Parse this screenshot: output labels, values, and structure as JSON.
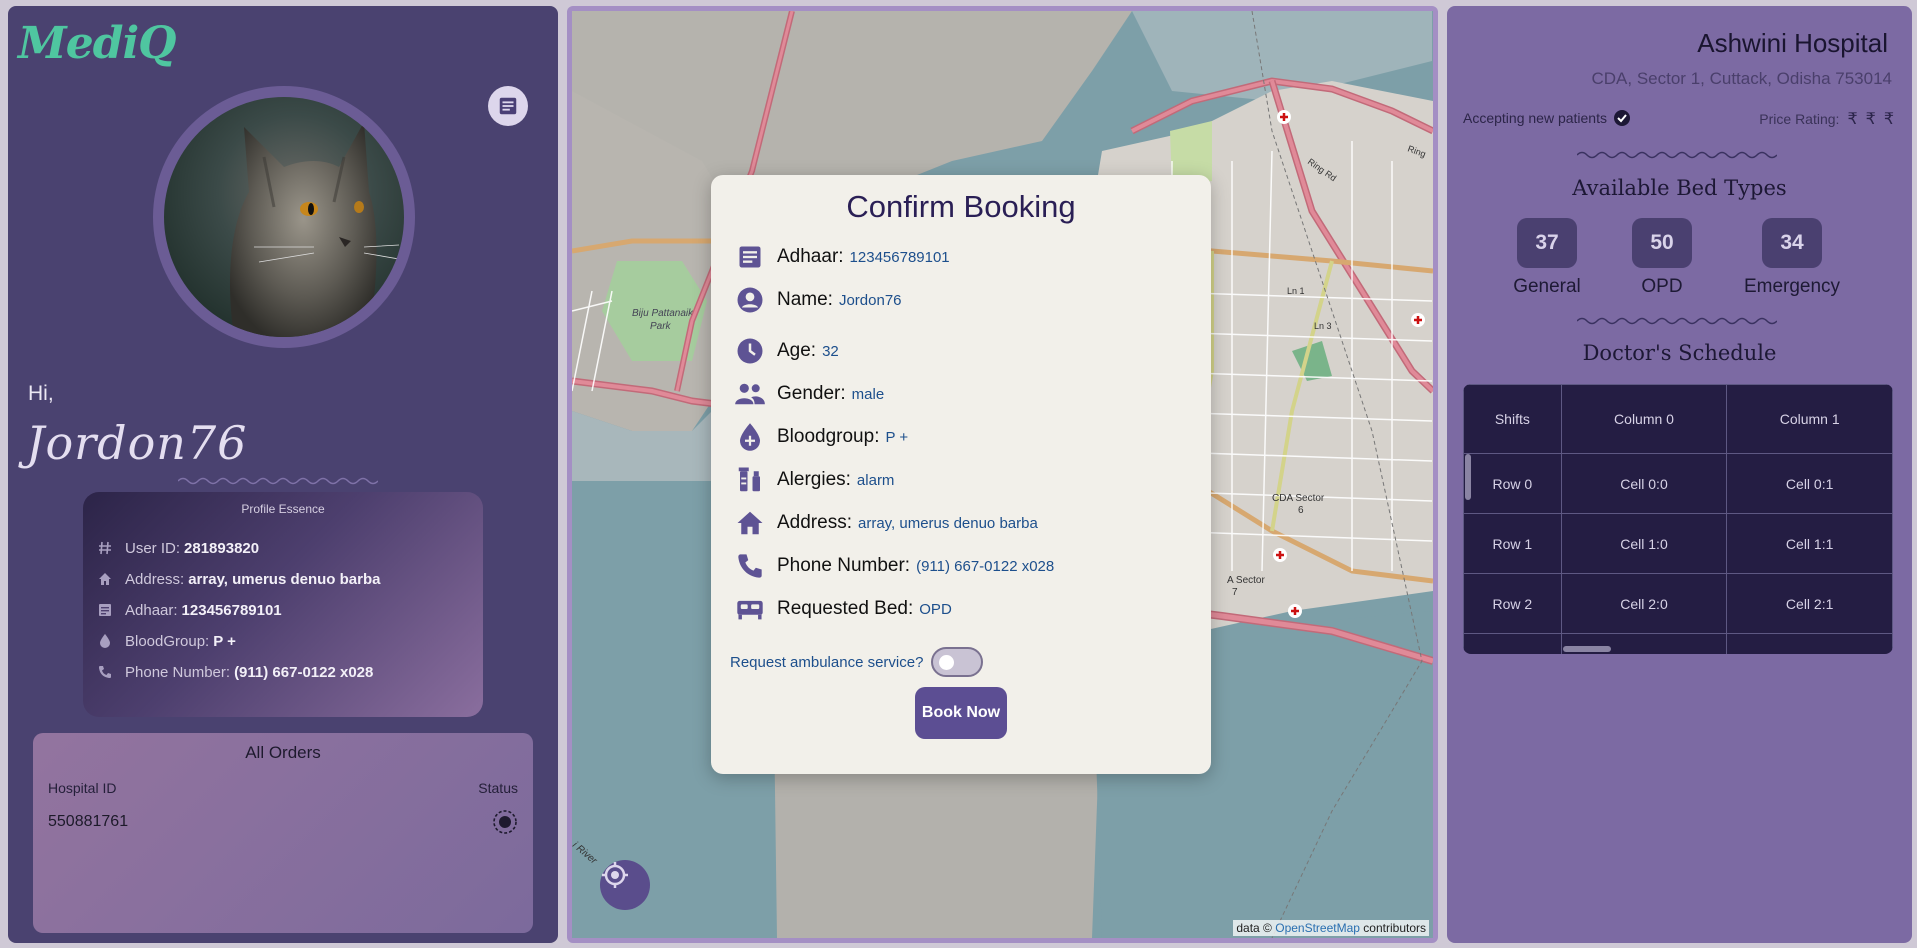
{
  "app": {
    "logo": "MediQ"
  },
  "profile": {
    "greeting": "Hi,",
    "username": "Jordon76",
    "essence_title": "Profile Essence",
    "rows": [
      {
        "icon": "hash-icon",
        "label": "User ID:",
        "value": "281893820"
      },
      {
        "icon": "home-icon",
        "label": "Address:",
        "value": "array, umerus denuo barba"
      },
      {
        "icon": "document-icon",
        "label": "Adhaar:",
        "value": "123456789101"
      },
      {
        "icon": "blood-drop-icon",
        "label": "BloodGroup:",
        "value": "P +"
      },
      {
        "icon": "phone-icon",
        "label": "Phone Number:",
        "value": "(911) 667-0122 x028"
      }
    ]
  },
  "orders": {
    "title": "All Orders",
    "col_hospital": "Hospital ID",
    "col_status": "Status",
    "items": [
      {
        "hospital_id": "550881761",
        "status_icon": "pending-status-icon"
      }
    ]
  },
  "map": {
    "attribution_prefix": "data ©",
    "attribution_link": "OpenStreetMap",
    "attribution_suffix": "contributors",
    "labels": {
      "park": "Biju Pattanaik Park",
      "sector6": "CDA Sector 6",
      "sector7": "A Sector 7",
      "ring": "Ring Rd",
      "ln1": "Ln 1",
      "ln3": "Ln 3",
      "river": "i River",
      "ring2": "Ring"
    }
  },
  "modal": {
    "title": "Confirm Booking",
    "rows": [
      {
        "icon": "document-icon",
        "label": "Adhaar:",
        "value": "123456789101"
      },
      {
        "icon": "person-circle-icon",
        "label": "Name:",
        "value": "Jordon76"
      },
      {
        "icon": "clock-icon",
        "label": "Age:",
        "value": "32"
      },
      {
        "icon": "people-icon",
        "label": "Gender:",
        "value": "male"
      },
      {
        "icon": "blood-drop-icon",
        "label": "Bloodgroup:",
        "value": "P +"
      },
      {
        "icon": "vaccine-icon",
        "label": "Alergies:",
        "value": "alarm"
      },
      {
        "icon": "home-icon",
        "label": "Address:",
        "value": "array, umerus denuo barba"
      },
      {
        "icon": "phone-icon",
        "label": "Phone Number:",
        "value": "(911) 667-0122 x028"
      },
      {
        "icon": "bed-icon",
        "label": "Requested Bed:",
        "value": "OPD"
      }
    ],
    "ambulance_label": "Request ambulance service?",
    "ambulance_on": false,
    "book_label": "Book Now"
  },
  "hospital": {
    "name": "Ashwini Hospital",
    "address": "CDA, Sector 1, Cuttack, Odisha 753014",
    "accepting": "Accepting new patients",
    "price_label": "Price Rating:",
    "price_symbols": [
      "₹",
      "₹",
      "₹"
    ],
    "beds_title": "Available Bed Types",
    "beds": [
      {
        "count": "37",
        "label": "General"
      },
      {
        "count": "50",
        "label": "OPD"
      },
      {
        "count": "34",
        "label": "Emergency"
      }
    ],
    "schedule_title": "Doctor's Schedule",
    "schedule_headers": [
      "Shifts",
      "Column 0",
      "Column 1"
    ],
    "schedule_rows": [
      [
        "Row 0",
        "Cell 0:0",
        "Cell 0:1"
      ],
      [
        "Row 1",
        "Cell 1:0",
        "Cell 1:1"
      ],
      [
        "Row 2",
        "Cell 2:0",
        "Cell 2:1"
      ],
      [
        "",
        "",
        ""
      ]
    ]
  },
  "colors": {
    "accent": "#5c4e93",
    "logo": "#4fc6a0",
    "panel": "#4a4270"
  }
}
